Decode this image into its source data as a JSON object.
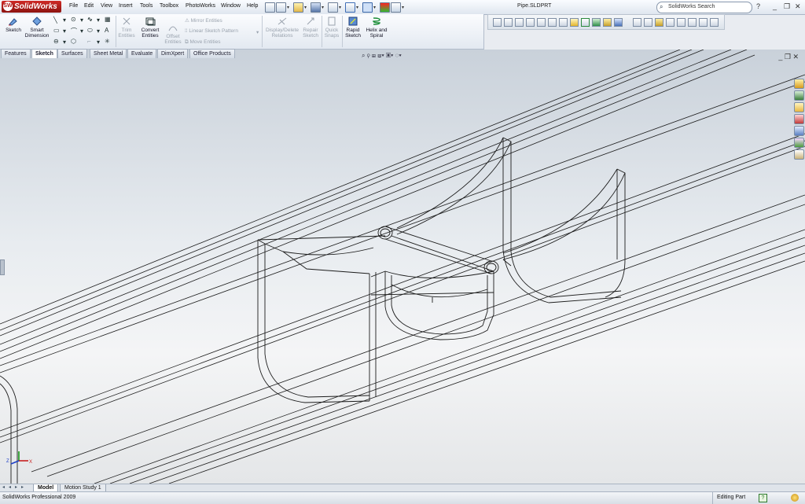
{
  "app": {
    "logo_text": "SolidWorks",
    "document_title": "Pipe.SLDPRT",
    "menu": [
      "File",
      "Edit",
      "View",
      "Insert",
      "Tools",
      "Toolbox",
      "PhotoWorks",
      "Window",
      "Help"
    ],
    "search_placeholder": "SolidWorks Search",
    "help_label": "?",
    "win_min": "_",
    "win_restore": "❐",
    "win_close": "✕"
  },
  "command_manager": {
    "sketch": "Sketch",
    "smart_dimension_1": "Smart",
    "smart_dimension_2": "Dimension",
    "trim_1": "Trim",
    "trim_2": "Entities",
    "convert_1": "Convert",
    "convert_2": "Entities",
    "offset_1": "Offset",
    "offset_2": "Entities",
    "mirror": "Mirror Entities",
    "linear_pattern": "Linear Sketch Pattern",
    "move": "Move Entities",
    "display_delete_1": "Display/Delete",
    "display_delete_2": "Relations",
    "repair_1": "Repair",
    "repair_2": "Sketch",
    "quick_snaps_1": "Quick",
    "quick_snaps_2": "Snaps",
    "rapid_sketch_1": "Rapid",
    "rapid_sketch_2": "Sketch",
    "helix_1": "Helix and",
    "helix_2": "Spiral"
  },
  "tabs": [
    "Features",
    "Sketch",
    "Surfaces",
    "Sheet Metal",
    "Evaluate",
    "DimXpert",
    "Office Products"
  ],
  "bottom_tabs": [
    "Model",
    "Motion Study 1"
  ],
  "status": {
    "product": "SolidWorks Professional 2009",
    "mode": "Editing Part",
    "help_icon": "?"
  },
  "triad": {
    "x": "X",
    "y": "Y",
    "z": "Z"
  },
  "colors": {
    "logo_red": "#b01a17",
    "viewport_top": "#c9d1da",
    "viewport_bottom": "#f4f5f6",
    "edge": "#1c1c1c"
  }
}
